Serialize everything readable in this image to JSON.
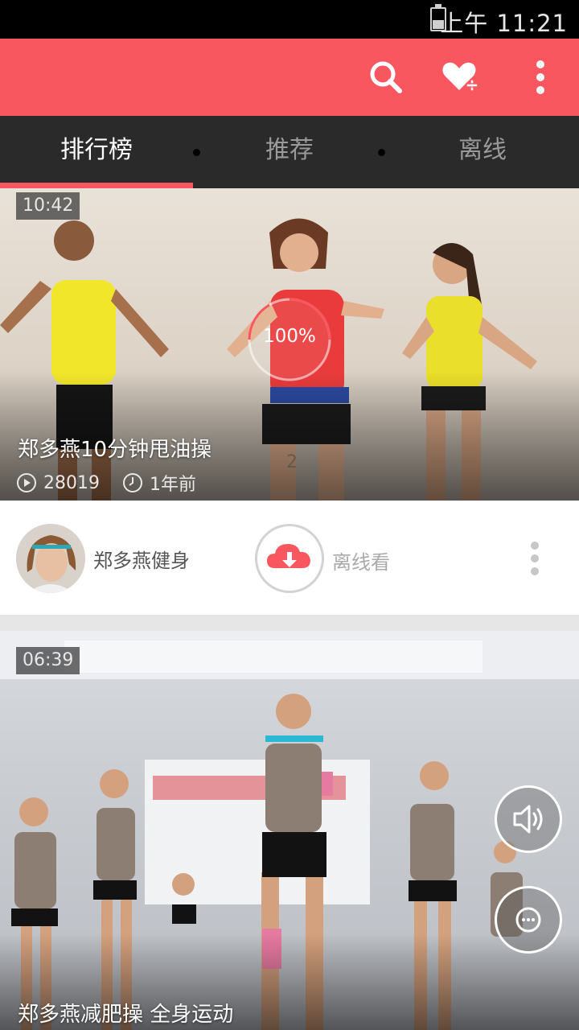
{
  "status_bar": {
    "time": "上午 11:21"
  },
  "tabs": [
    {
      "label": "排行榜",
      "active": true
    },
    {
      "label": "推荐",
      "active": false
    },
    {
      "label": "离线",
      "active": false
    }
  ],
  "videos": [
    {
      "duration": "10:42",
      "title": "郑多燕10分钟甩油操",
      "views": "28019",
      "age": "1年前",
      "download_progress_label": "100%",
      "download_progress": 1.0,
      "overlay_number": "2",
      "channel": "郑多燕健身",
      "offline_label": "离线看"
    },
    {
      "duration": "06:39",
      "title": "郑多燕减肥操 全身运动"
    }
  ],
  "colors": {
    "accent": "#f9575f",
    "tab_bar": "#2a2a2a",
    "status_bar": "#000000"
  },
  "icons": [
    "search-icon",
    "heart-plus-icon",
    "more-vert-icon",
    "play-count-icon",
    "clock-icon",
    "cloud-download-icon",
    "volume-icon",
    "comment-icon"
  ]
}
